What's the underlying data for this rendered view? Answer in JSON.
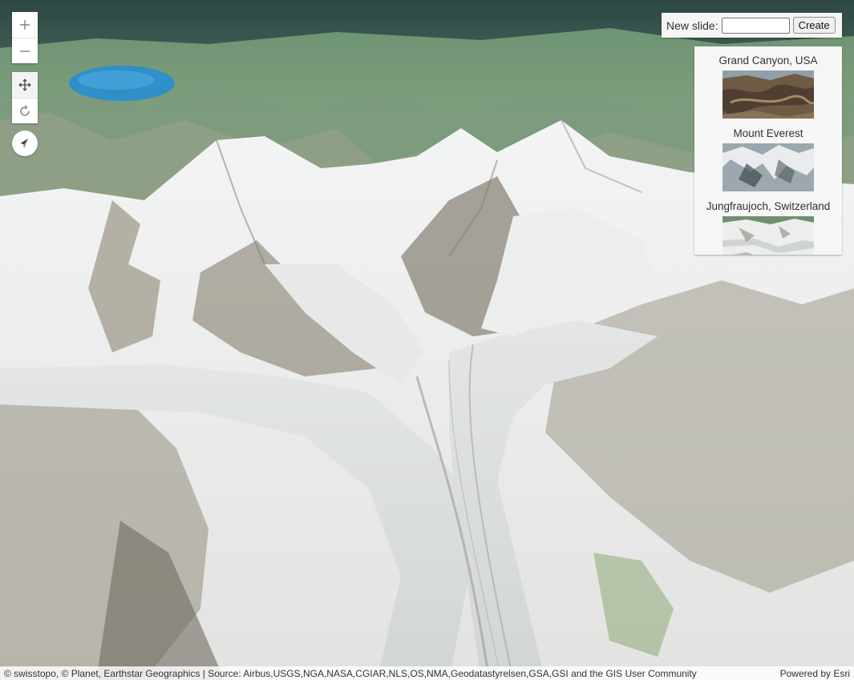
{
  "view": {
    "sky_color": "#2f4a4a",
    "lake_color": "#2f8fc9",
    "snow_color": "#eef0f0",
    "rock_color": "#8a8576",
    "forest_color": "#5f8a60"
  },
  "controls": {
    "zoom_in_icon": "plus-icon",
    "zoom_out_icon": "minus-icon",
    "pan_icon": "pan-arrows-icon",
    "rotate_icon": "rotate-icon",
    "compass_icon": "compass-icon"
  },
  "new_slide": {
    "label": "New slide:",
    "input_value": "",
    "button_label": "Create"
  },
  "slides": [
    {
      "title": "Grand Canyon, USA"
    },
    {
      "title": "Mount Everest"
    },
    {
      "title": "Jungfraujoch, Switzerland"
    }
  ],
  "attribution": {
    "sources": "© swisstopo, © Planet, Earthstar Geographics | Source: Airbus,USGS,NGA,NASA,CGIAR,NLS,OS,NMA,Geodatastyrelsen,GSA,GSI and the GIS User Community",
    "powered_by": "Powered by Esri"
  }
}
